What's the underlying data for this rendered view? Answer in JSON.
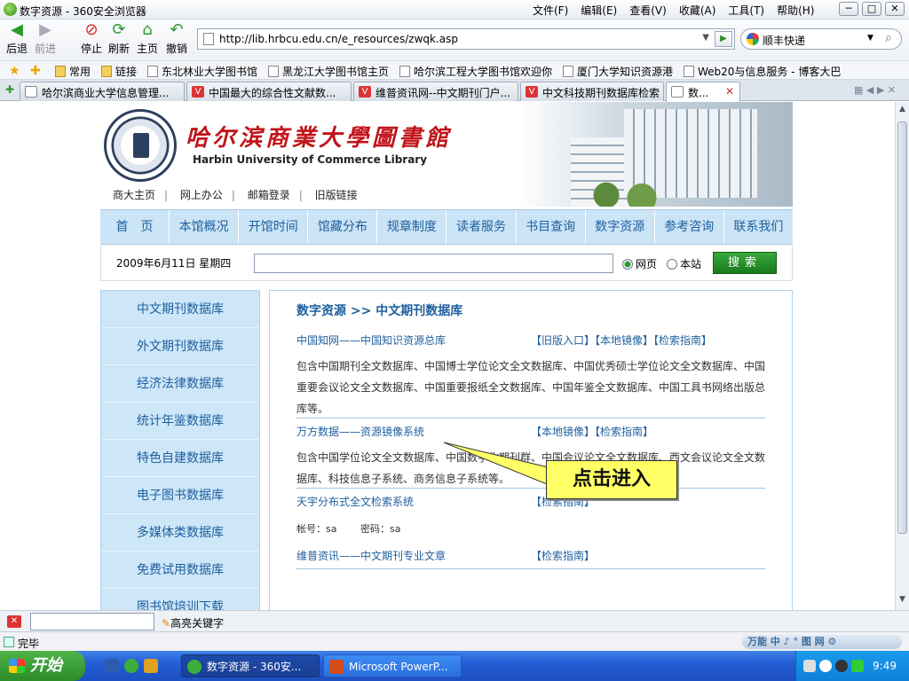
{
  "browser": {
    "title": "数字资源 - 360安全浏览器",
    "menu": [
      "文件(F)",
      "编辑(E)",
      "查看(V)",
      "收藏(A)",
      "工具(T)",
      "帮助(H)"
    ],
    "toolbar": [
      "后退",
      "前进",
      "停止",
      "刷新",
      "主页",
      "撤销"
    ],
    "url": "http://lib.hrbcu.edu.cn/e_resources/zwqk.asp",
    "search_engine": "顺丰快递",
    "favorites": [
      "常用",
      "链接",
      "东北林业大学图书馆",
      "黑龙江大学图书馆主页",
      "哈尔滨工程大学图书馆欢迎你",
      "厦门大学知识资源港",
      "Web20与信息服务 - 博客大巴"
    ],
    "tabs": [
      "哈尔滨商业大学信息管理...",
      "中国最大的综合性文献数...",
      "维普资讯网--中文期刊门户...",
      "中文科技期刊数据库检索",
      "数..."
    ],
    "find_label": "高亮关键字",
    "status": "完毕",
    "status_right": "万能 中 ♪ ° 图 网 ⚙"
  },
  "library": {
    "name_cn": "哈尔滨商業大學圖書館",
    "name_en": "Harbin University of Commerce Library",
    "top_links": [
      "商大主页",
      "网上办公",
      "邮箱登录",
      "旧版链接"
    ],
    "nav": [
      "首　页",
      "本馆概况",
      "开馆时间",
      "馆藏分布",
      "规章制度",
      "读者服务",
      "书目查询",
      "数字资源",
      "参考咨询",
      "联系我们"
    ],
    "date": "2009年6月11日  星期四",
    "radio_web": "网页",
    "radio_site": "本站",
    "search_btn": "搜索"
  },
  "sidebar": [
    "中文期刊数据库",
    "外文期刊数据库",
    "经济法律数据库",
    "统计年鉴数据库",
    "特色自建数据库",
    "电子图书数据库",
    "多媒体类数据库",
    "免费试用数据库",
    "图书馆培训下载"
  ],
  "content": {
    "breadcrumb": "数字资源  >>  中文期刊数据库",
    "entries": [
      {
        "title": "中国知网——中国知识资源总库",
        "links": "【旧版入口】【本地镜像】【检索指南】",
        "desc": "包含中国期刊全文数据库、中国博士学位论文全文数据库、中国优秀硕士学位论文全文数据库、中国重要会议论文全文数据库、中国重要报纸全文数据库、中国年鉴全文数据库、中国工具书网络出版总库等。"
      },
      {
        "title": "万方数据——资源镜像系统",
        "links": "【本地镜像】【检索指南】",
        "desc": "包含中国学位论文全文数据库、中国数字化期刊群、中国会议论文全文数据库、西文会议论文全文数据库、科技信息子系统、商务信息子系统等。"
      },
      {
        "title": "天宇分布式全文检索系统",
        "links": "【检索指南】",
        "desc": ""
      },
      {
        "title": "维普资讯——中文期刊专业文章",
        "links": "【检索指南】",
        "desc": ""
      }
    ],
    "account_label": "帐号：sa",
    "password_label": "密码：sa"
  },
  "callout": "点击进入",
  "taskbar": {
    "start": "开始",
    "tasks": [
      "数字资源 - 360安...",
      "Microsoft PowerP..."
    ],
    "clock": "9:49"
  }
}
